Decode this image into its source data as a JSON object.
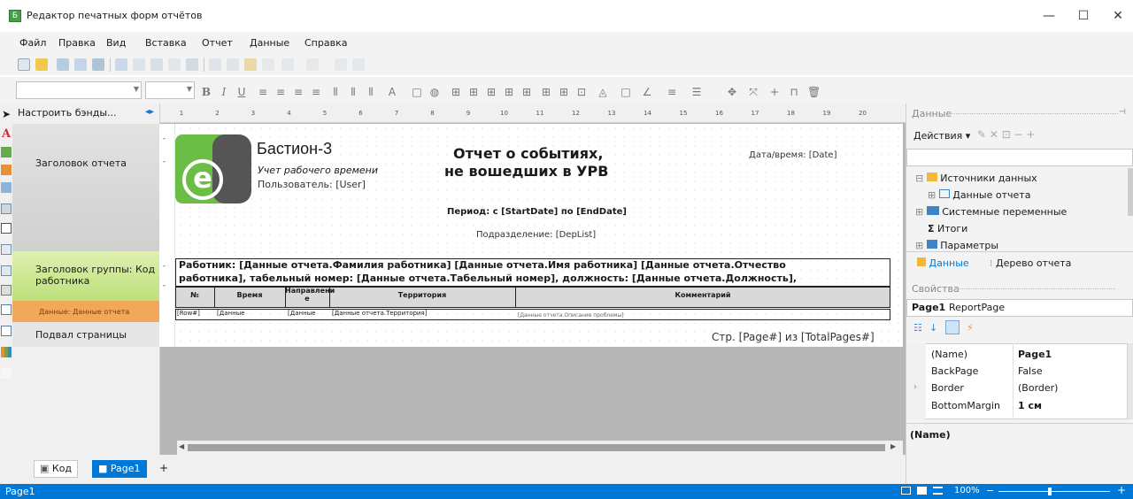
{
  "window": {
    "title": "Редактор печатных форм отчётов",
    "minimize": "—",
    "maximize": "☐",
    "close": "✕"
  },
  "menu": [
    "Файл",
    "Правка",
    "Вид",
    "Вставка",
    "Отчет",
    "Данные",
    "Справка"
  ],
  "bands_toolbar": "Настроить бэнды...",
  "bands": {
    "report_title": "Заголовок отчета",
    "group_header": "Заголовок группы: Код работника",
    "data": "Данные: Данные отчета",
    "page_footer": "Подвал страницы"
  },
  "ruler": [
    "1",
    "2",
    "3",
    "4",
    "5",
    "6",
    "7",
    "8",
    "9",
    "10",
    "11",
    "12",
    "13",
    "14",
    "15",
    "16",
    "17",
    "18",
    "19",
    "20"
  ],
  "report": {
    "logo_letter": "e",
    "company": "Бастион-3",
    "subtitle": "Учет рабочего времени",
    "user": "Пользователь: [User]",
    "title1": "Отчет о событиях,",
    "title2": "не вошедших в УРВ",
    "datetime": "Дата/время: [Date]",
    "period": "Период: с [StartDate] по [EndDate]",
    "division": "Подразделение: [DepList]",
    "worker1": "Работник: [Данные отчета.Фамилия работника] [Данные отчета.Имя работника] [Данные отчета.Отчество",
    "worker2": "работника], табельный номер: [Данные отчета.Табельный номер], должность: [Данные отчета.Должность],",
    "columns": [
      "№",
      "Время",
      "Направлени е",
      "Территория",
      "Комментарий"
    ],
    "row": [
      "[Row#]",
      "[Данные",
      "[Данные",
      "[Данные отчета.Территория]",
      "[Данные отчета.Описание проблемы]"
    ],
    "footer": "Стр. [Page#] из [TotalPages#]"
  },
  "tabs": {
    "code": "Код",
    "page": "Page1",
    "add": "+"
  },
  "status": {
    "left": "Page1",
    "zoom": "100%",
    "minus": "−",
    "plus": "+"
  },
  "data_panel": {
    "header": "Данные",
    "actions": "Действия",
    "tree": [
      "Источники данных",
      "Данные отчета",
      "Системные переменные",
      "Итоги",
      "Параметры"
    ],
    "tab_data": "Данные",
    "tab_tree": "Дерево отчета"
  },
  "props": {
    "header": "Свойства",
    "object": "Page1",
    "object_type": "ReportPage",
    "rows": [
      [
        "(Name)",
        "Page1"
      ],
      [
        "BackPage",
        "False"
      ],
      [
        "Border",
        "(Border)"
      ],
      [
        "BottomMargin",
        "1 см"
      ]
    ],
    "desc": "(Name)"
  }
}
